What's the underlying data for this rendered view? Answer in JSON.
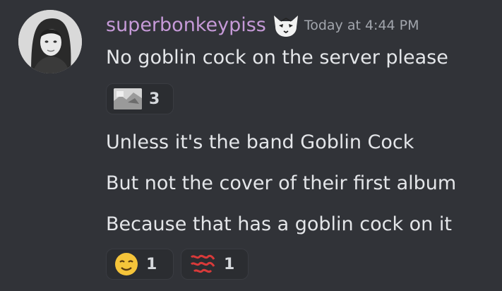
{
  "message": {
    "username": "superbonkeypiss",
    "timestamp": "Today at 4:44 PM",
    "lines": [
      "No goblin cock on the server please",
      "Unless it's the band Goblin Cock",
      "But not the cover of their first album",
      "Because that has a goblin cock on it"
    ],
    "reactions_first": [
      {
        "icon": "image-emoji",
        "count": "3"
      }
    ],
    "reactions_last": [
      {
        "icon": "relieved-face-emoji",
        "count": "1"
      },
      {
        "icon": "red-text-sticker-emoji",
        "count": "1"
      }
    ]
  },
  "colors": {
    "background": "#313338",
    "username": "#c69ad8",
    "text": "#e4e6e9",
    "timestamp": "#a2a6ad",
    "reaction_bg": "#2b2d31"
  }
}
